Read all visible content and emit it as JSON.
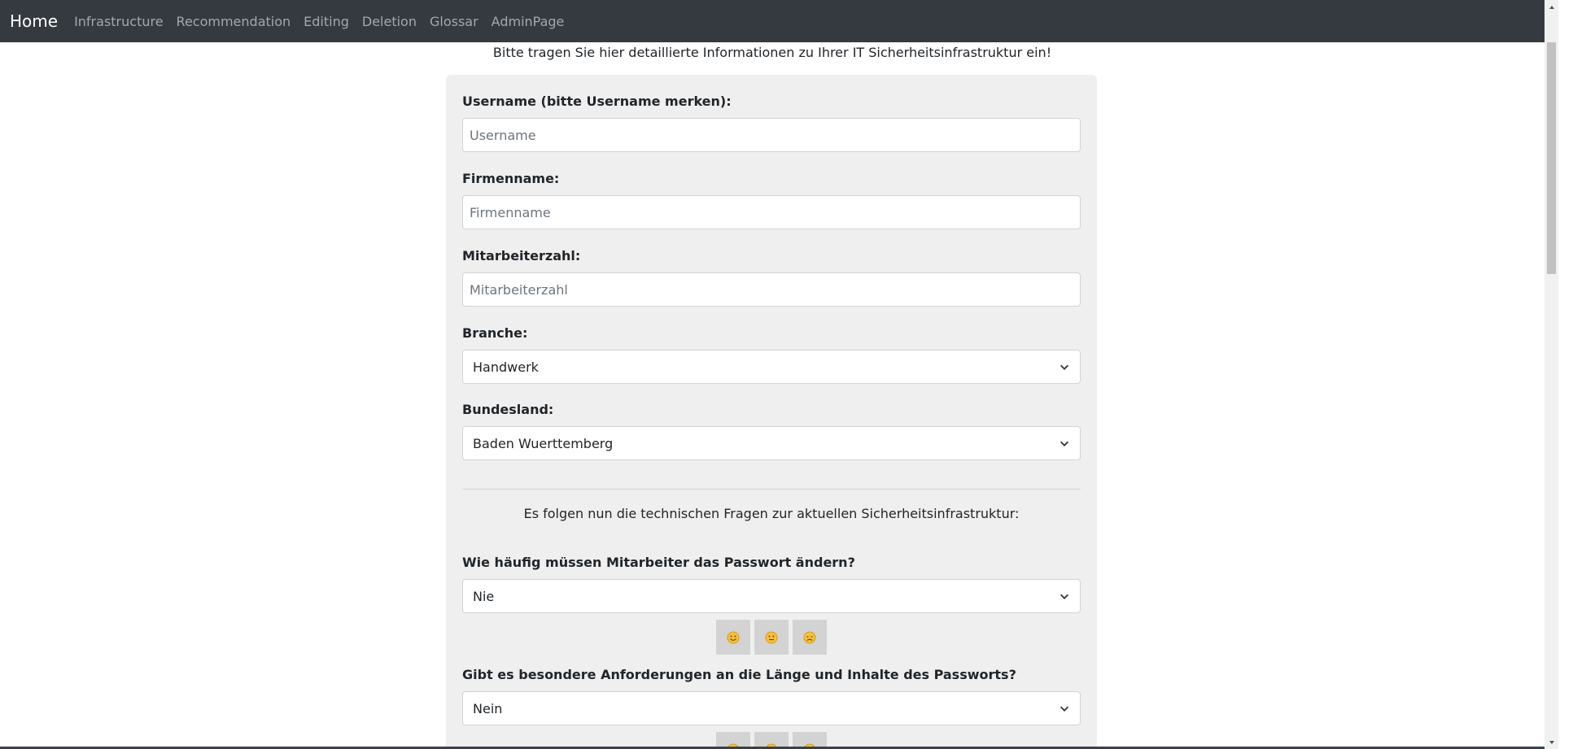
{
  "navbar": {
    "brand": "Home",
    "links": [
      "Infrastructure",
      "Recommendation",
      "Editing",
      "Deletion",
      "Glossar",
      "AdminPage"
    ]
  },
  "intro": "Bitte tragen Sie hier detaillierte Informationen zu Ihrer IT Sicherheitsinfrastruktur ein!",
  "form": {
    "username": {
      "label": "Username (bitte Username merken):",
      "placeholder": "Username",
      "value": ""
    },
    "firmenname": {
      "label": "Firmenname:",
      "placeholder": "Firmenname",
      "value": ""
    },
    "mitarbeiterzahl": {
      "label": "Mitarbeiterzahl:",
      "placeholder": "Mitarbeiterzahl",
      "value": ""
    },
    "branche": {
      "label": "Branche:",
      "selected": "Handwerk"
    },
    "bundesland": {
      "label": "Bundesland:",
      "selected": "Baden Wuerttemberg"
    }
  },
  "technical_intro": "Es folgen nun die technischen Fragen zur aktuellen Sicherheitsinfrastruktur:",
  "questions": [
    {
      "label": "Wie häufig müssen Mitarbeiter das Passwort ändern?",
      "selected": "Nie"
    },
    {
      "label": "Gibt es besondere Anforderungen an die Länge und Inhalte des Passworts?",
      "selected": "Nein"
    }
  ],
  "rating_icons": [
    "smiling-face-icon",
    "neutral-face-icon",
    "frowning-face-icon"
  ],
  "colors": {
    "navbar_bg": "#343a40",
    "card_bg": "#efefef",
    "rating_button_bg": "#d3d3d3"
  }
}
